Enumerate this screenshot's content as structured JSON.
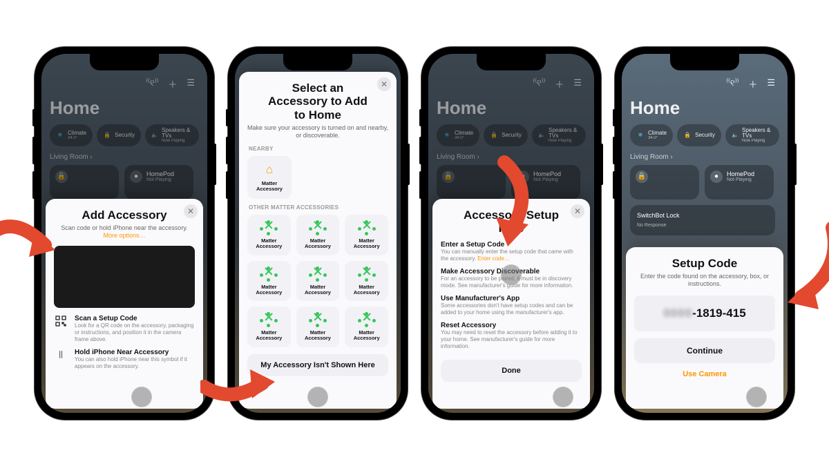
{
  "home": {
    "title": "Home",
    "chips": {
      "climate": {
        "label": "Climate",
        "sub": "34.0°"
      },
      "security": {
        "label": "Security"
      },
      "speakers": {
        "label": "Speakers & TVs",
        "sub": "Now Playing"
      }
    },
    "room": "Living Room",
    "tiles": {
      "lock": {
        "label": "SwitchBot Lock",
        "sub": "No Response"
      },
      "homepod": {
        "label": "HomePod",
        "sub": "Not Playing"
      },
      "locktile_sub": ""
    }
  },
  "sheet1": {
    "title": "Add Accessory",
    "sub_a": "Scan code or hold iPhone near the accessory.",
    "more": "More options…",
    "opt1_title": "Scan a Setup Code",
    "opt1_desc": "Look for a QR code on the accessory, packaging or instructions, and position it in the camera frame above.",
    "opt2_title": "Hold iPhone Near Accessory",
    "opt2_desc": "You can also hold iPhone near this symbol if it appears on the accessory."
  },
  "sheet2": {
    "title": "Select an Accessory to Add to Home",
    "sub": "Make sure your accessory is turned on and nearby, or discoverable.",
    "section_nearby": "NEARBY",
    "nearby_label": "Matter Accessory",
    "section_other": "OTHER MATTER ACCESSORIES",
    "cell_label": "Matter Accessory",
    "bottom": "My Accessory Isn't Shown Here"
  },
  "sheet3": {
    "title": "Accessory Setup Help",
    "items": [
      {
        "t": "Enter a Setup Code",
        "d": "You can manually enter the setup code that came with the accessory. ",
        "link": "Enter code…"
      },
      {
        "t": "Make Accessory Discoverable",
        "d": "For an accessory to be paired, it must be in discovery mode. See manufacturer's guide for more information."
      },
      {
        "t": "Use Manufacturer's App",
        "d": "Some accessories don't have setup codes and can be added to your home using the manufacturer's app."
      },
      {
        "t": "Reset Accessory",
        "d": "You may need to reset the accessory before adding it to your home. See manufacturer's guide for more information."
      }
    ],
    "done": "Done"
  },
  "sheet4": {
    "title": "Setup Code",
    "sub": "Enter the code found on the accessory, box, or instructions.",
    "code_hidden": "0000",
    "code_visible": "-1819-415",
    "continue": "Continue",
    "use_camera": "Use Camera"
  }
}
